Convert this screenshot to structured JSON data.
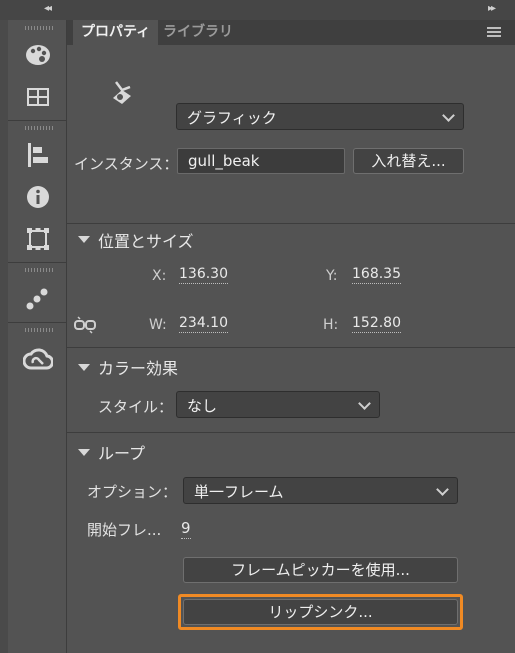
{
  "tabs": {
    "properties": "プロパティ",
    "library": "ライブラリ"
  },
  "top_strip": {
    "collapse_left": "◂◂",
    "collapse_right": "▸▸"
  },
  "toolbar": {
    "icons": [
      "palette-icon",
      "swatches-icon",
      "align-icon",
      "info-icon",
      "transform-icon",
      "components-icon",
      "creative-cloud-icon"
    ]
  },
  "instance": {
    "behavior": "グラフィック",
    "instance_label": "インスタンス：",
    "instance_name": "gull_beak",
    "swap_button": "入れ替え..."
  },
  "position_size": {
    "title": "位置とサイズ",
    "x_label": "X:",
    "x_value": "136.30",
    "y_label": "Y:",
    "y_value": "168.35",
    "w_label": "W:",
    "w_value": "234.10",
    "h_label": "H:",
    "h_value": "152.80"
  },
  "color_effect": {
    "title": "カラー効果",
    "style_label": "スタイル：",
    "style_value": "なし"
  },
  "loop": {
    "title": "ループ",
    "option_label": "オプション：",
    "option_value": "単一フレーム",
    "first_frame_label": "開始フレ...",
    "first_frame_value": "9",
    "frame_picker_button": "フレームピッカーを使用...",
    "lip_sync_button": "リップシンク..."
  },
  "colors": {
    "panel_bg": "#535353",
    "highlight": "#f08a24"
  }
}
